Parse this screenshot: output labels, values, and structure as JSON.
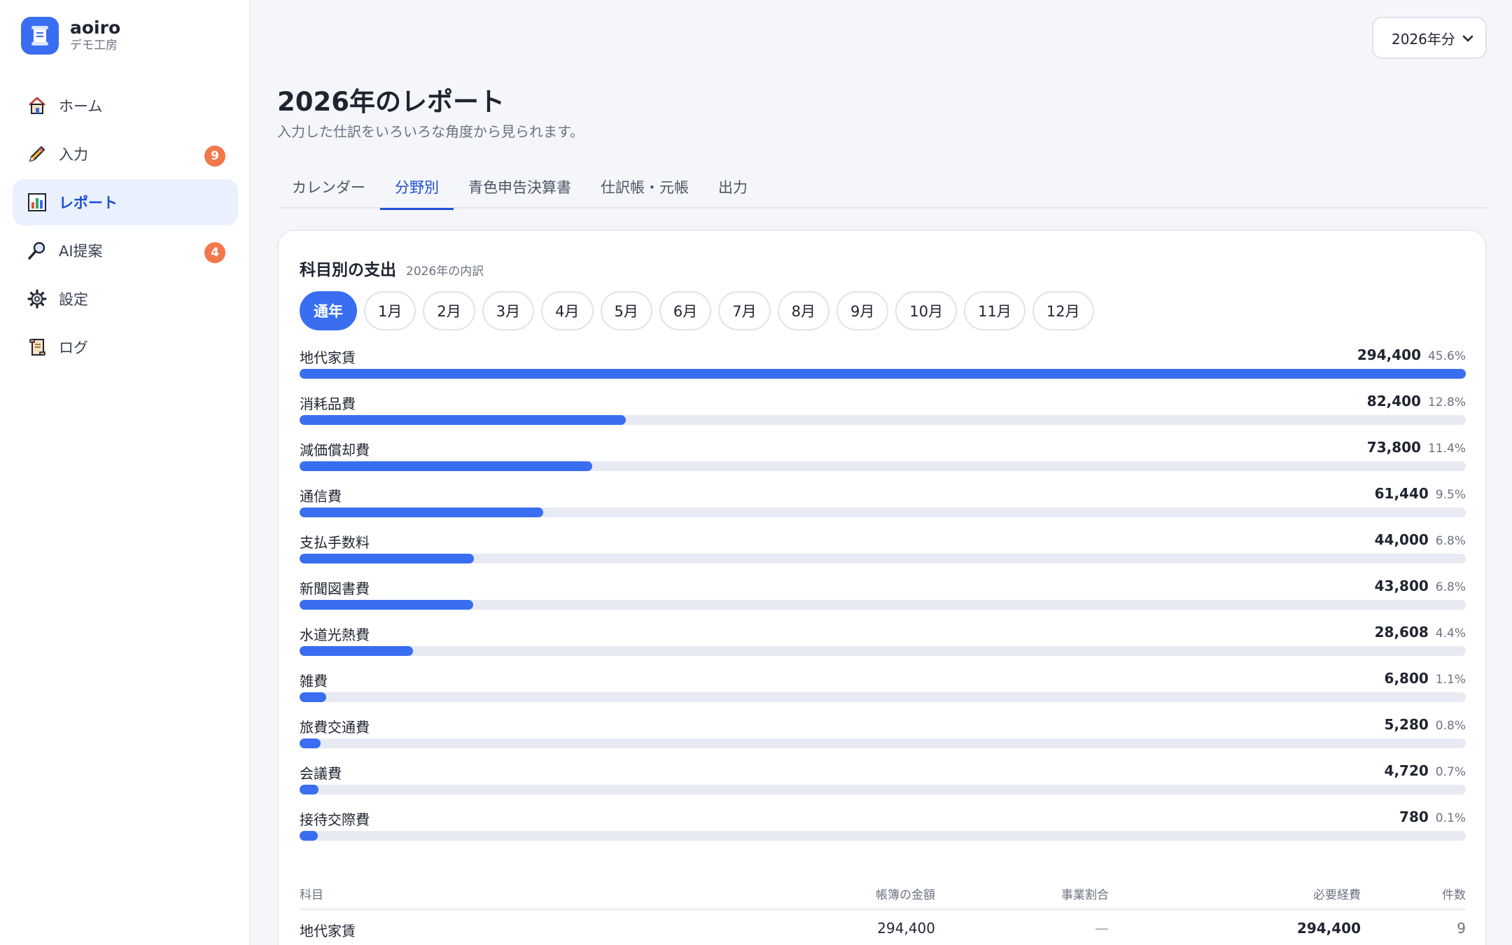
{
  "brand": {
    "name": "aoiro",
    "sub": "デモ工房"
  },
  "sidebar": {
    "items": [
      {
        "label": "ホーム",
        "icon": "house-icon",
        "badge": ""
      },
      {
        "label": "入力",
        "icon": "pencil-icon",
        "badge": "9"
      },
      {
        "label": "レポート",
        "icon": "bar-chart-icon",
        "badge": ""
      },
      {
        "label": "AI提案",
        "icon": "magnifier-icon",
        "badge": "4"
      },
      {
        "label": "設定",
        "icon": "gear-icon",
        "badge": ""
      },
      {
        "label": "ログ",
        "icon": "scroll-icon",
        "badge": ""
      }
    ]
  },
  "header": {
    "year_select": "2026年分",
    "title": "2026年のレポート",
    "subtitle": "入力した仕訳をいろいろな角度から見られます。"
  },
  "tabs": [
    "カレンダー",
    "分野別",
    "青色申告決算書",
    "仕訳帳・元帳",
    "出力"
  ],
  "card": {
    "title": "科目別の支出",
    "subtitle": "2026年の内訳"
  },
  "months": [
    "通年",
    "1月",
    "2月",
    "3月",
    "4月",
    "5月",
    "6月",
    "7月",
    "8月",
    "9月",
    "10月",
    "11月",
    "12月"
  ],
  "colors": {
    "accent": "#3a6ef0",
    "badge": "#f2784b",
    "track": "#e8eaf3"
  },
  "chart_data": {
    "type": "bar",
    "categories": [
      "地代家賃",
      "消耗品費",
      "減価償却費",
      "通信費",
      "支払手数料",
      "新聞図書費",
      "水道光熱費",
      "雑費",
      "旅費交通費",
      "会議費",
      "接待交際費"
    ],
    "values": [
      294400,
      82400,
      73800,
      61440,
      44000,
      43800,
      28608,
      6800,
      5280,
      4720,
      780
    ],
    "amount_labels": [
      "294,400",
      "82,400",
      "73,800",
      "61,440",
      "44,000",
      "43,800",
      "28,608",
      "6,800",
      "5,280",
      "4,720",
      "780"
    ],
    "percent_labels": [
      "45.6%",
      "12.8%",
      "11.4%",
      "9.5%",
      "6.8%",
      "6.8%",
      "4.4%",
      "1.1%",
      "0.8%",
      "0.7%",
      "0.1%"
    ],
    "xlim": [
      0,
      294400
    ]
  },
  "table": {
    "headers": [
      "科目",
      "帳簿の金額",
      "事業割合",
      "必要経費",
      "件数"
    ],
    "rows": [
      [
        "地代家賃",
        "294,400",
        "—",
        "294,400",
        "9"
      ]
    ]
  }
}
